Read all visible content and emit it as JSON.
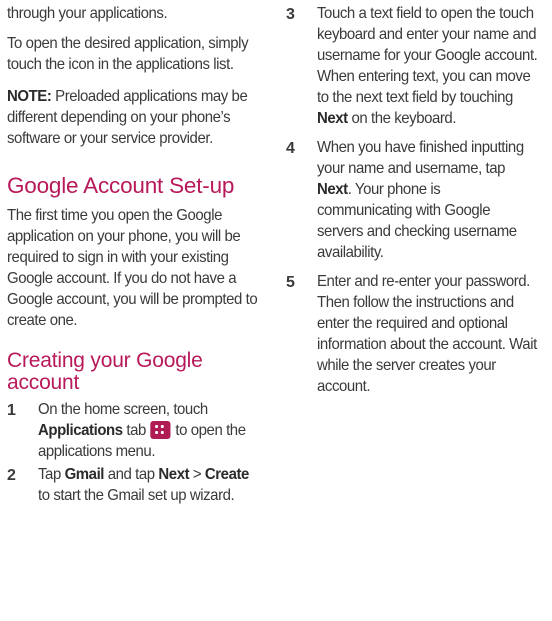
{
  "left": {
    "intro_line": "through your applications.",
    "open_app": "To open the desired application, simply touch the icon in the applications list.",
    "note_label": "NOTE:",
    "note_text": " Preloaded applications may be different depending on your phone’s software or your service provider.",
    "section_title": "Google Account Set-up",
    "section_body": "The first time you open the Google application on your phone, you will be required to sign in with your existing Google account. If you do not have a Google account, you will be prompted to create one.",
    "subsection_title": "Creating your Google account",
    "steps": [
      {
        "num": "1",
        "t1": "On the home screen, touch ",
        "b1": "Applications",
        "t2": " tab ",
        "icon": "applications-grid-icon",
        "t3": " to open the applications menu."
      },
      {
        "num": "2",
        "t1": "Tap ",
        "b1": "Gmail",
        "t2": " and tap ",
        "b2": "Next",
        "t3": " > ",
        "b3": "Create",
        "t4": " to start the Gmail set up wizard."
      }
    ]
  },
  "right": {
    "steps": [
      {
        "num": "3",
        "t1": "Touch a text field to open the touch keyboard and enter your name and username for your Google account. When entering text, you can move to the next text field by touching ",
        "b1": "Next",
        "t2": " on the keyboard."
      },
      {
        "num": "4",
        "t1": "When you have finished inputting your name and username, tap ",
        "b1": "Next",
        "t2": ". Your phone is communicating with Google servers and checking username availability."
      },
      {
        "num": "5",
        "t1": "Enter and re-enter your password. Then follow the instructions and enter the required and optional information about the account. Wait while the server creates your account."
      }
    ]
  },
  "colors": {
    "heading": "#b8195a",
    "body_text": "#3a3a3a",
    "icon_bg": "#b01b53"
  }
}
